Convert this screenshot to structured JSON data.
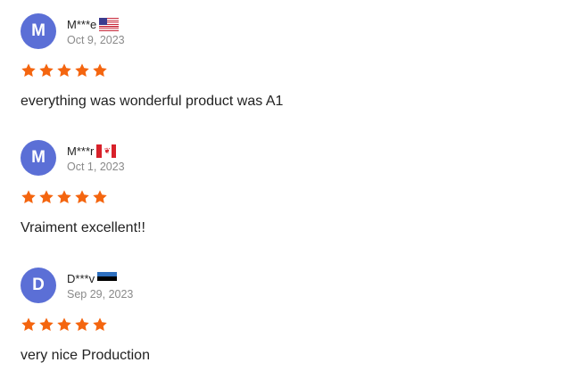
{
  "colors": {
    "star": "#f4650f",
    "avatar_bg": "#5b6fd6",
    "date_text": "#8a8a8a"
  },
  "reviews": [
    {
      "initial": "M",
      "name": "M***e",
      "flag": "us-flag-icon",
      "date": "Oct 9, 2023",
      "rating": 5,
      "text": "everything was wonderful product was A1"
    },
    {
      "initial": "M",
      "name": "M***r",
      "flag": "ca-flag-icon",
      "date": "Oct 1, 2023",
      "rating": 5,
      "text": "Vraiment excellent!!"
    },
    {
      "initial": "D",
      "name": "D***v",
      "flag": "ee-flag-icon",
      "date": "Sep 29, 2023",
      "rating": 5,
      "text": "very nice Production"
    }
  ]
}
